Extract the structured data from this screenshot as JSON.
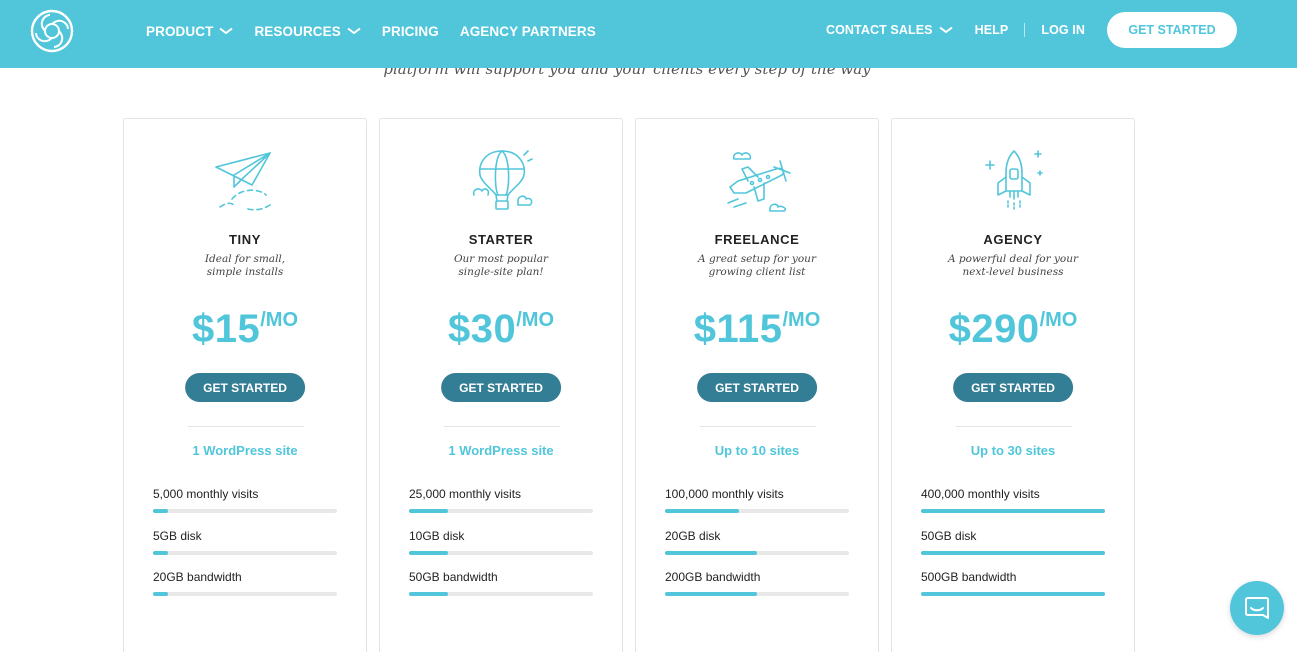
{
  "colors": {
    "brand": "#51c6db",
    "cta_dark": "#337e94"
  },
  "nav": {
    "left": [
      {
        "label": "PRODUCT",
        "has_dropdown": true
      },
      {
        "label": "RESOURCES",
        "has_dropdown": true
      },
      {
        "label": "PRICING",
        "has_dropdown": false
      },
      {
        "label": "AGENCY PARTNERS",
        "has_dropdown": false
      }
    ],
    "contact_sales": "CONTACT SALES",
    "help": "HELP",
    "login": "LOG IN",
    "get_started": "GET STARTED"
  },
  "subtitle": "platform will support you and your clients every step of the way",
  "plans": [
    {
      "icon": "paper-plane-icon",
      "name": "TINY",
      "desc1": "Ideal for small,",
      "desc2": "simple installs",
      "price": "$15",
      "per": "/MO",
      "cta": "GET STARTED",
      "sites": "1 WordPress site",
      "metrics": [
        {
          "label": "5,000 monthly visits",
          "fill": 0.08
        },
        {
          "label": "5GB disk",
          "fill": 0.08
        },
        {
          "label": "20GB bandwidth",
          "fill": 0.08
        }
      ]
    },
    {
      "icon": "hot-air-balloon-icon",
      "name": "STARTER",
      "desc1": "Our most popular",
      "desc2": "single-site plan!",
      "price": "$30",
      "per": "/MO",
      "cta": "GET STARTED",
      "sites": "1 WordPress site",
      "metrics": [
        {
          "label": "25,000 monthly visits",
          "fill": 0.21
        },
        {
          "label": "10GB disk",
          "fill": 0.21
        },
        {
          "label": "50GB bandwidth",
          "fill": 0.21
        }
      ]
    },
    {
      "icon": "propeller-plane-icon",
      "name": "FREELANCE",
      "desc1": "A great setup for your",
      "desc2": "growing client list",
      "price": "$115",
      "per": "/MO",
      "cta": "GET STARTED",
      "sites": "Up to 10 sites",
      "metrics": [
        {
          "label": "100,000 monthly visits",
          "fill": 0.4
        },
        {
          "label": "20GB disk",
          "fill": 0.5
        },
        {
          "label": "200GB bandwidth",
          "fill": 0.5
        }
      ]
    },
    {
      "icon": "rocket-icon",
      "name": "AGENCY",
      "desc1": "A powerful deal for your",
      "desc2": "next-level business",
      "price": "$290",
      "per": "/MO",
      "cta": "GET STARTED",
      "sites": "Up to 30 sites",
      "metrics": [
        {
          "label": "400,000 monthly visits",
          "fill": 1.0
        },
        {
          "label": "50GB disk",
          "fill": 1.0
        },
        {
          "label": "500GB bandwidth",
          "fill": 1.0
        }
      ]
    }
  ],
  "chat": {
    "icon": "chat-icon"
  }
}
